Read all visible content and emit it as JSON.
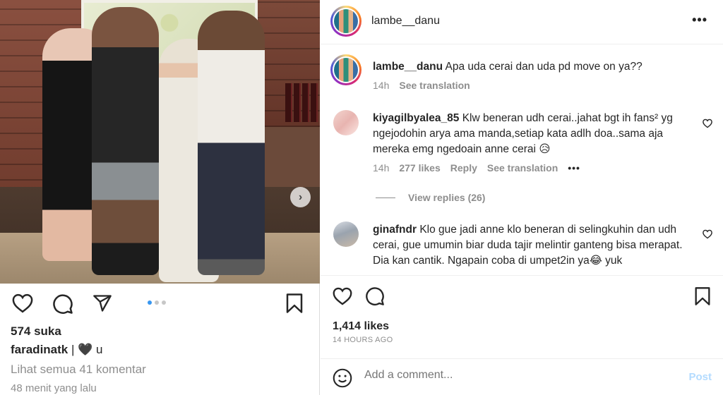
{
  "left": {
    "likes": "574 suka",
    "caption_user": "faradinatk",
    "caption_text": " | 🖤 u",
    "view_all": "Lihat semua 41 komentar",
    "time_ago": "48 menit yang lalu",
    "carousel": {
      "count": 3,
      "active": 0
    }
  },
  "right": {
    "header": {
      "username": "lambe__danu"
    },
    "post": {
      "username": "lambe__danu",
      "text": "Apa uda cerai dan uda pd move on ya??",
      "time": "14h",
      "see_translation": "See translation"
    },
    "comments": [
      {
        "username": "kiyagilbyalea_85",
        "text": "Klw beneran udh cerai..jahat bgt ih fans² yg ngejodohin arya ama manda,setiap kata adlh doa..sama aja mereka emg ngedoain anne cerai 😥",
        "time": "14h",
        "likes": "277 likes",
        "reply": "Reply",
        "see_translation": "See translation",
        "more": "•••",
        "view_replies": "View replies (26)"
      },
      {
        "username": "ginafndr",
        "text": "Klo gue jadi anne klo beneran di selingkuhin dan udh cerai, gue umumin biar duda tajir melintir ganteng bisa merapat. Dia kan cantik. Ngapain coba di umpet2in ya😂 yuk"
      }
    ],
    "likes": "1,414 likes",
    "time": "14 HOURS AGO",
    "add_comment_placeholder": "Add a comment...",
    "post_button": "Post",
    "more_button": "•••"
  },
  "colors": {
    "accent": "#3897f0",
    "muted": "#8e8e8e",
    "post_disabled": "#b3dbff"
  },
  "icons": [
    "heart-icon",
    "comment-icon",
    "share-icon",
    "bookmark-icon",
    "emoji-icon",
    "chevron-right-icon"
  ]
}
